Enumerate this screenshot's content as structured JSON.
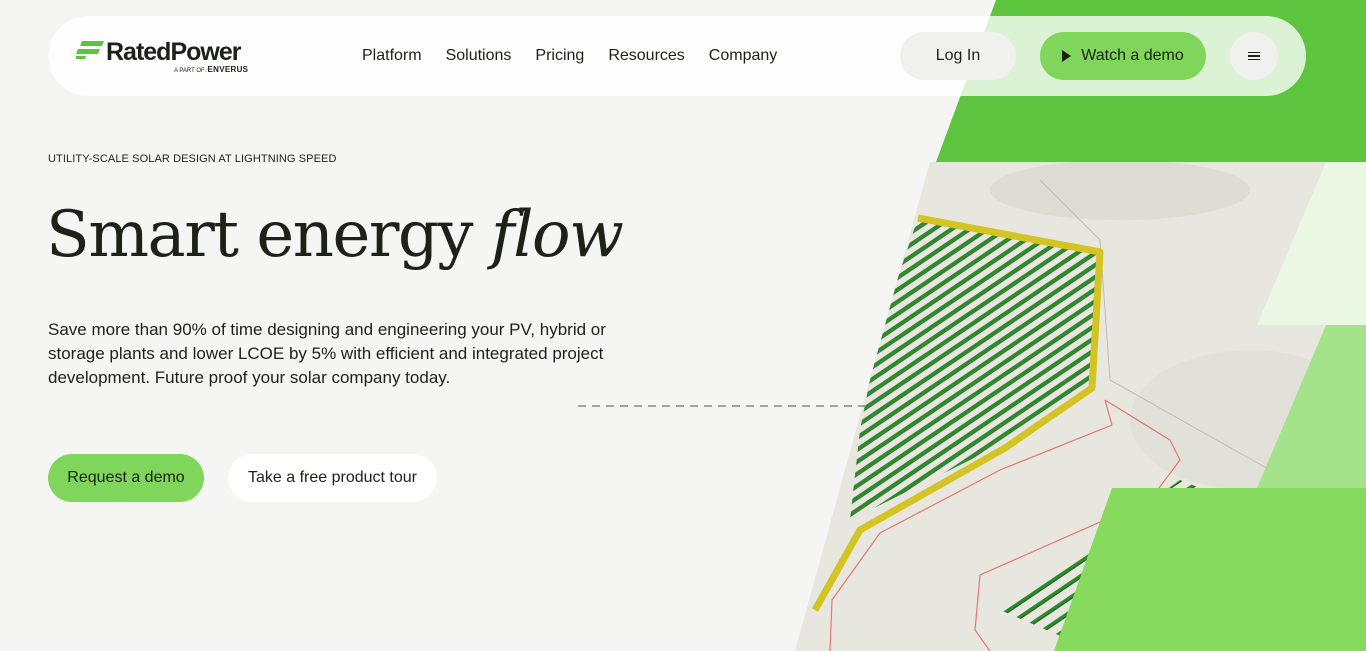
{
  "brand": {
    "name": "RatedPower",
    "sub_prefix": "A PART OF",
    "sub_brand": "ENVERUS",
    "accent": "#7fd65a",
    "accent_dark": "#5cc53d"
  },
  "nav": {
    "items": [
      {
        "label": "Platform"
      },
      {
        "label": "Solutions"
      },
      {
        "label": "Pricing"
      },
      {
        "label": "Resources"
      },
      {
        "label": "Company"
      }
    ],
    "login_label": "Log In",
    "watch_label": "Watch a demo",
    "menu_icon": "hamburger-icon",
    "play_icon": "play-icon"
  },
  "hero": {
    "eyebrow": "UTILITY-SCALE SOLAR DESIGN AT LIGHTNING SPEED",
    "title_main": "Smart energy ",
    "title_em": "flow",
    "lead": "Save more than 90% of time designing and engineering your PV, hybrid or storage plants and lower LCOE by 5% with efficient and integrated project development. Future proof your solar company today.",
    "primary_cta": "Request a demo",
    "secondary_cta": "Take a free product tour"
  }
}
